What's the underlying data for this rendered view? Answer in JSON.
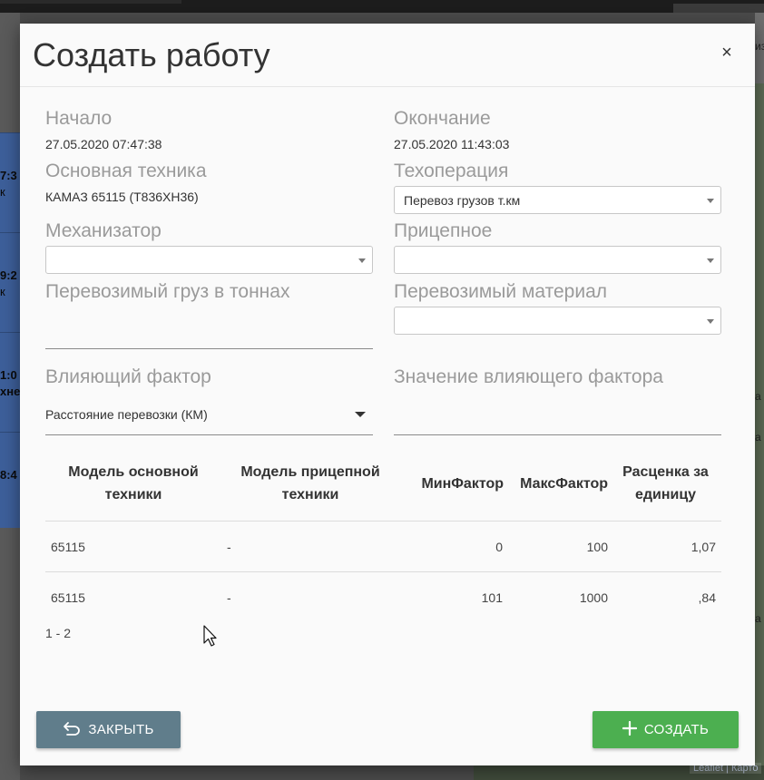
{
  "background": {
    "left_rows": [
      {
        "line1": "7:3",
        "line2": "к"
      },
      {
        "line1": "9:2",
        "line2": "к"
      },
      {
        "line1": "1:0",
        "line2": "хне"
      },
      {
        "line1": "8:4",
        "line2": ""
      }
    ],
    "right_fragments": [
      "из",
      "а",
      "а",
      "а"
    ],
    "map_attribution": "Leaflet | Карто"
  },
  "modal": {
    "title": "Создать работу",
    "close_label": "×",
    "fields": {
      "start_label": "Начало",
      "start_value": "27.05.2020 07:47:38",
      "end_label": "Окончание",
      "end_value": "27.05.2020 11:43:03",
      "main_equipment_label": "Основная техника",
      "main_equipment_value": "КАМАЗ 65115 (Т836ХН36)",
      "operation_label": "Техоперация",
      "operation_value": "Перевоз грузов т.км",
      "operator_label": "Механизатор",
      "operator_value": "",
      "trailer_label": "Прицепное",
      "trailer_value": "",
      "cargo_tons_label": "Перевозимый груз в тоннах",
      "cargo_tons_value": "",
      "material_label": "Перевозимый материал",
      "material_value": "",
      "factor_label": "Влияющий фактор",
      "factor_value": "Расстояние перевозки (КМ)",
      "factor_value_label": "Значение влияющего фактора",
      "factor_value_value": ""
    },
    "table": {
      "headers": {
        "main_model_l1": "Модель основной",
        "main_model_l2": "техники",
        "trailer_model_l1": "Модель прицепной",
        "trailer_model_l2": "техники",
        "min_factor": "МинФактор",
        "max_factor": "МаксФактор",
        "rate_l1": "Расценка за",
        "rate_l2": "единицу"
      },
      "rows": [
        {
          "main_model": "65115",
          "trailer_model": "-",
          "min": "0",
          "max": "100",
          "rate": "1,07"
        },
        {
          "main_model": "65115",
          "trailer_model": "-",
          "min": "101",
          "max": "1000",
          "rate": ",84"
        }
      ],
      "pager": "1 - 2"
    },
    "buttons": {
      "close_label": "ЗАКРЫТЬ",
      "create_label": "СОЗДАТЬ",
      "close_icon": "undo-arrow-icon",
      "create_icon": "plus-icon"
    }
  }
}
